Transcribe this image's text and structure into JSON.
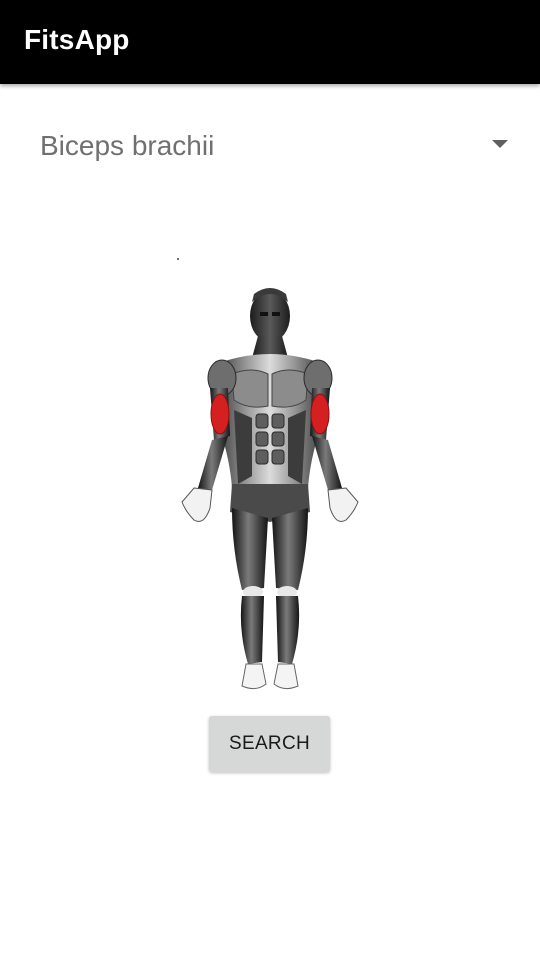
{
  "app_bar": {
    "title": "FitsApp",
    "background": "#000000"
  },
  "muscle_selector": {
    "selected_value": "Biceps brachii",
    "icon": "dropdown-arrow-icon"
  },
  "body_diagram": {
    "icon": "human-anatomy-front-figure",
    "highlighted_muscle": "Biceps brachii",
    "highlight_color": "#d42020"
  },
  "search_button": {
    "label": "SEARCH"
  }
}
